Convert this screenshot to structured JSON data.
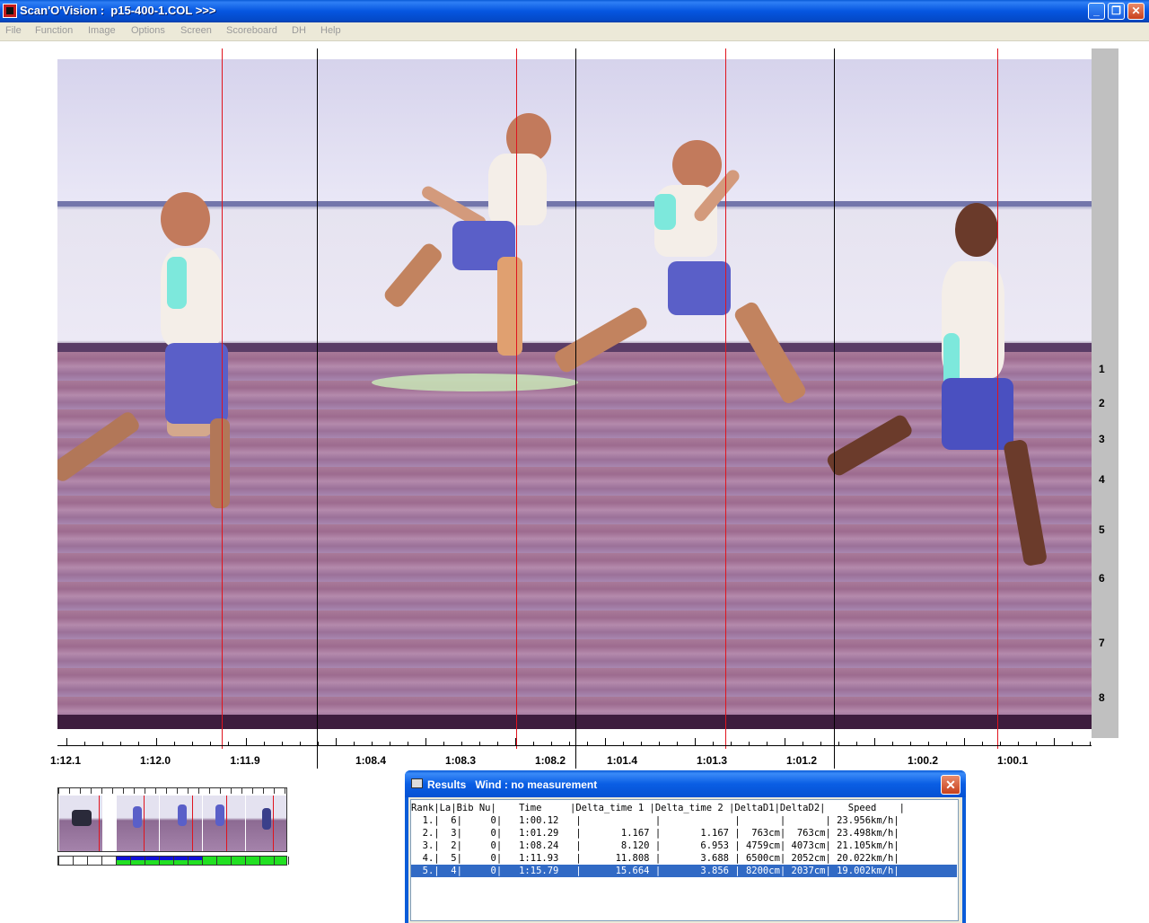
{
  "window": {
    "title": "Scan'O'Vision :  p15-400-1.COL >>>",
    "controls": {
      "minimize": "_",
      "maximize": "❐",
      "close": "✕"
    }
  },
  "menu": [
    "File",
    "Function",
    "Image",
    "Options",
    "Screen",
    "Scoreboard",
    "DH",
    "Help"
  ],
  "lanes": [
    "1",
    "2",
    "3",
    "4",
    "5",
    "6",
    "7",
    "8"
  ],
  "time_axis": {
    "labels": [
      "1:12.1",
      "1:12.0",
      "1:11.9",
      "1:08.4",
      "1:08.3",
      "1:08.2",
      "1:01.4",
      "1:01.3",
      "1:01.2",
      "1:00.2",
      "1:00.1"
    ]
  },
  "results": {
    "title": "Results   Wind : no measurement",
    "close": "✕",
    "header": "Rank|La|Bib Nu|    Time     |Delta_time 1 |Delta_time 2 |DeltaD1|DeltaD2|    Speed    |",
    "rows": [
      "  1.|  6|     0|   1:00.12   |             |             |       |       | 23.956km/h|",
      "  2.|  3|     0|   1:01.29   |       1.167 |       1.167 |  763cm|  763cm| 23.498km/h|",
      "  3.|  2|     0|   1:08.24   |       8.120 |       6.953 | 4759cm| 4073cm| 21.105km/h|",
      "  4.|  5|     0|   1:11.93   |      11.808 |       3.688 | 6500cm| 2052cm| 20.022km/h|",
      "  5.|  4|     0|   1:15.79   |      15.664 |       3.856 | 8200cm| 2037cm| 19.002km/h|"
    ],
    "selected_row": 5
  },
  "colors": {
    "finish_line": "#e0141e",
    "selection": "#316ac5",
    "titlebar": "#0556e0",
    "progress_green": "#22e022"
  },
  "icons": [
    "app-icon",
    "printer-icon",
    "close-icon",
    "minimize-icon",
    "maximize-icon"
  ]
}
